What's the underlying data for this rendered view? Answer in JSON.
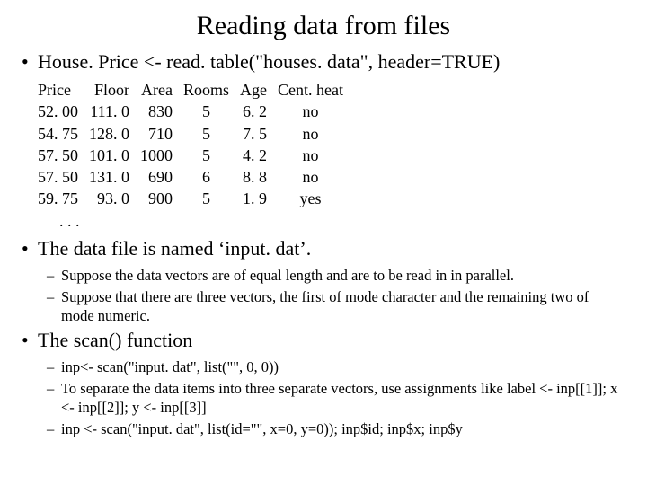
{
  "title": "Reading data from files",
  "bullet1": "House. Price <- read. table(\"houses. data\", header=TRUE)",
  "table": {
    "headers": [
      "Price",
      "Floor",
      "Area",
      "Rooms",
      "Age",
      "Cent. heat"
    ],
    "rows": [
      [
        "52. 00",
        "111. 0",
        "830",
        "5",
        "6. 2",
        "no"
      ],
      [
        "54. 75",
        "128. 0",
        "710",
        "5",
        "7. 5",
        "no"
      ],
      [
        "57. 50",
        "101. 0",
        "1000",
        "5",
        "4. 2",
        "no"
      ],
      [
        "57. 50",
        "131. 0",
        "690",
        "6",
        "8. 8",
        "no"
      ],
      [
        "59. 75",
        "93. 0",
        "900",
        "5",
        "1. 9",
        "yes"
      ]
    ],
    "ellipsis": ". . ."
  },
  "bullet2": "The data file is named ‘input. dat’.",
  "sub2a": "Suppose the data vectors are of equal length and are to be read in in parallel.",
  "sub2b": "Suppose that there are three vectors, the first of mode character and the remaining two of mode numeric.",
  "bullet3": "The scan() function",
  "sub3a": "inp<- scan(\"input. dat\", list(\"\", 0, 0))",
  "sub3b": "To separate the data items into three separate vectors, use assignments like label <- inp[[1]]; x <- inp[[2]]; y <- inp[[3]]",
  "sub3c": "inp <- scan(\"input. dat\", list(id=\"\", x=0, y=0));  inp$id; inp$x; inp$y"
}
